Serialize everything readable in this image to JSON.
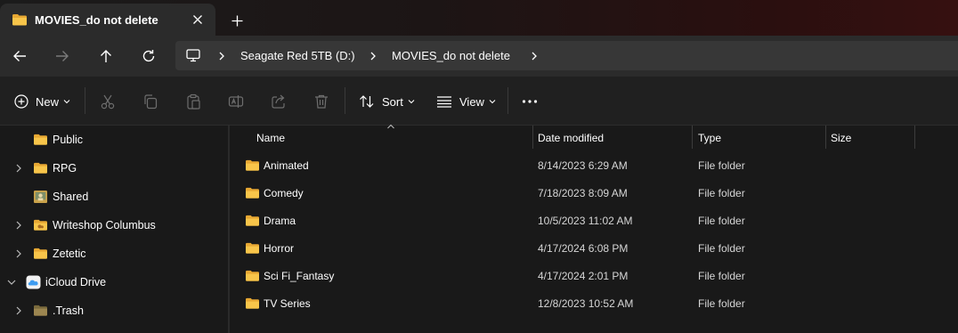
{
  "tab": {
    "title": "MOVIES_do not delete",
    "close_icon": "close-icon",
    "new_tab_icon": "plus-icon"
  },
  "nav": {
    "back_icon": "arrow-left-icon",
    "forward_icon": "arrow-right-icon",
    "up_icon": "arrow-up-icon",
    "refresh_icon": "refresh-icon"
  },
  "address": {
    "root_icon": "computer-icon",
    "crumbs": [
      "Seagate Red 5TB (D:)",
      "MOVIES_do not delete"
    ]
  },
  "toolbar": {
    "new_label": "New",
    "sort_label": "Sort",
    "view_label": "View",
    "icons": [
      "cut-icon",
      "copy-icon",
      "paste-icon",
      "rename-icon",
      "share-icon",
      "delete-icon",
      "more-icon"
    ]
  },
  "sidebar": {
    "items": [
      {
        "label": "Public",
        "icon": "folder-icon",
        "expandable": false,
        "expanded": false
      },
      {
        "label": "RPG",
        "icon": "folder-icon",
        "expandable": true,
        "expanded": false
      },
      {
        "label": "Shared",
        "icon": "shared-folder-icon",
        "expandable": false,
        "expanded": false
      },
      {
        "label": "Writeshop Columbus",
        "icon": "shared-folder-icon",
        "expandable": true,
        "expanded": false
      },
      {
        "label": "Zetetic",
        "icon": "folder-icon",
        "expandable": true,
        "expanded": false
      },
      {
        "label": "iCloud Drive",
        "icon": "icloud-icon",
        "expandable": true,
        "expanded": true
      },
      {
        "label": ".Trash",
        "icon": "folder-icon",
        "expandable": true,
        "expanded": false
      }
    ]
  },
  "columns": {
    "name": "Name",
    "date": "Date modified",
    "type": "Type",
    "size": "Size"
  },
  "files": [
    {
      "name": "Animated",
      "date": "8/14/2023 6:29 AM",
      "type": "File folder",
      "size": ""
    },
    {
      "name": "Comedy",
      "date": "7/18/2023 8:09 AM",
      "type": "File folder",
      "size": ""
    },
    {
      "name": "Drama",
      "date": "10/5/2023 11:02 AM",
      "type": "File folder",
      "size": ""
    },
    {
      "name": "Horror",
      "date": "4/17/2024 6:08 PM",
      "type": "File folder",
      "size": ""
    },
    {
      "name": "Sci Fi_Fantasy",
      "date": "4/17/2024 2:01 PM",
      "type": "File folder",
      "size": ""
    },
    {
      "name": "TV Series",
      "date": "12/8/2023 10:52 AM",
      "type": "File folder",
      "size": ""
    }
  ],
  "colors": {
    "background": "#191919",
    "toolbar": "#202020",
    "address_bar": "#373737",
    "folder_yellow": "#f8c54a",
    "text": "#ffffff"
  }
}
